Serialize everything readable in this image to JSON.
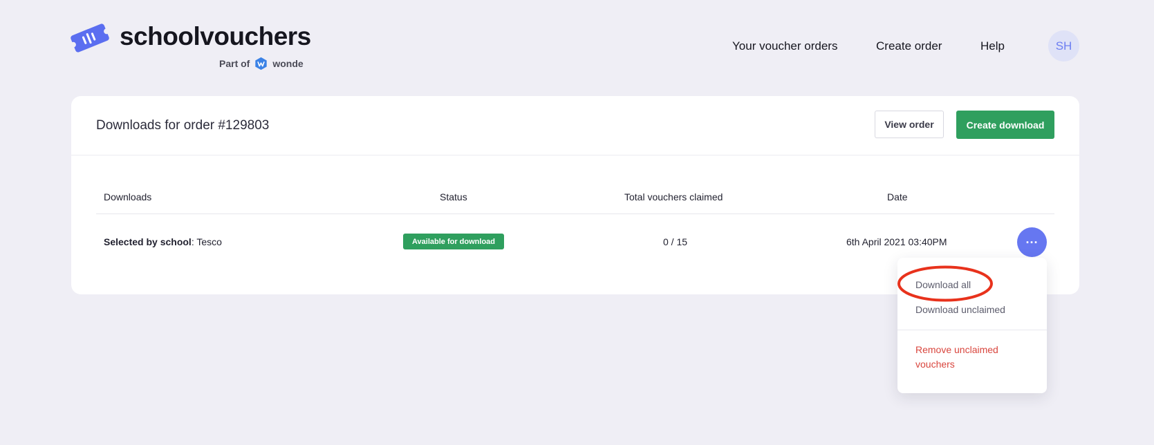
{
  "brand": {
    "name": "schoolvouchers",
    "part_of": "Part of",
    "partner": "wonde",
    "accent": "#5b6ef0"
  },
  "nav": {
    "orders": "Your voucher orders",
    "create": "Create order",
    "help": "Help",
    "avatar_initials": "SH"
  },
  "card": {
    "title": "Downloads for order #129803",
    "view_order": "View order",
    "create_download": "Create download"
  },
  "table": {
    "headers": [
      "Downloads",
      "Status",
      "Total vouchers claimed",
      "Date"
    ],
    "row": {
      "label": "Selected by school",
      "value": ": Tesco",
      "status": "Available for download",
      "claimed": "0 / 15",
      "date": "6th April 2021 03:40PM",
      "more": "···"
    }
  },
  "menu": {
    "download_all": "Download all",
    "download_unclaimed": "Download unclaimed",
    "remove_unclaimed": "Remove unclaimed vouchers"
  },
  "colors": {
    "background": "#efeef5",
    "primary_green": "#2f9f5e",
    "more_button": "#6677f1",
    "danger": "#d9453d",
    "highlight_ring": "#e8321c"
  }
}
